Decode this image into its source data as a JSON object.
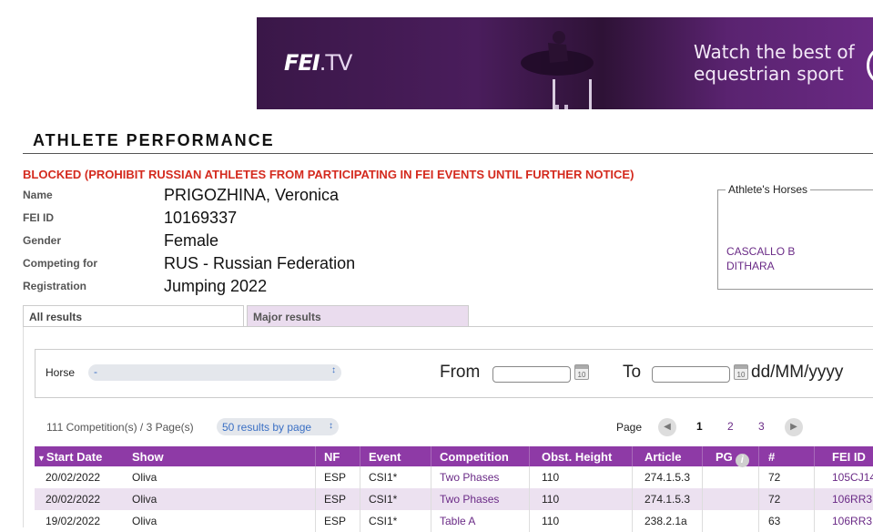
{
  "banner": {
    "logo": "FEI",
    "logo_suffix": ".TV",
    "tagline_line1": "Watch the best of",
    "tagline_line2": "equestrian sport",
    "accent": "#4a1d5c"
  },
  "page_title": "ATHLETE PERFORMANCE",
  "blocked_notice": "BLOCKED (PROHIBIT RUSSIAN ATHLETES FROM PARTICIPATING IN FEI EVENTS UNTIL FURTHER NOTICE)",
  "athlete": {
    "name_label": "Name",
    "name": "PRIGOZHINA, Veronica",
    "feiid_label": "FEI ID",
    "feiid": "10169337",
    "gender_label": "Gender",
    "gender": "Female",
    "competing_label": "Competing for",
    "competing": "RUS - Russian Federation",
    "registration_label": "Registration",
    "registration": "Jumping 2022"
  },
  "horses": {
    "legend": "Athlete's Horses",
    "items": [
      "CASCALLO B",
      "DITHARA"
    ]
  },
  "tabs": [
    {
      "label": "All results",
      "active": true
    },
    {
      "label": "Major results",
      "active": false
    }
  ],
  "filters": {
    "horse_label": "Horse",
    "horse_value": "-",
    "from_label": "From",
    "to_label": "To",
    "date_format": "dd/MM/yyyy",
    "calendar_icon_text": "10"
  },
  "pagination": {
    "summary": "111 Competition(s) / 3 Page(s)",
    "per_page": "50 results by page",
    "page_label": "Page",
    "pages": [
      "1",
      "2",
      "3"
    ],
    "current_page": "1"
  },
  "table": {
    "headers": [
      "Start Date",
      "Show",
      "NF",
      "Event",
      "Competition",
      "Obst. Height",
      "Article",
      "PG",
      "#",
      "FEI ID"
    ],
    "rows": [
      [
        "20/02/2022",
        "Oliva",
        "ESP",
        "CSI1*",
        "Two Phases",
        "110",
        "274.1.5.3",
        "",
        "72",
        "105CJ14"
      ],
      [
        "20/02/2022",
        "Oliva",
        "ESP",
        "CSI1*",
        "Two Phases",
        "110",
        "274.1.5.3",
        "",
        "72",
        "106RR3"
      ],
      [
        "19/02/2022",
        "Oliva",
        "ESP",
        "CSI1*",
        "Table A",
        "110",
        "238.2.1a",
        "",
        "63",
        "106RR3"
      ]
    ]
  },
  "colors": {
    "header_purple": "#8e3aa6",
    "link_purple": "#6a2a86",
    "blocked_red": "#d42a1e",
    "alt_row": "#ece1f0"
  }
}
